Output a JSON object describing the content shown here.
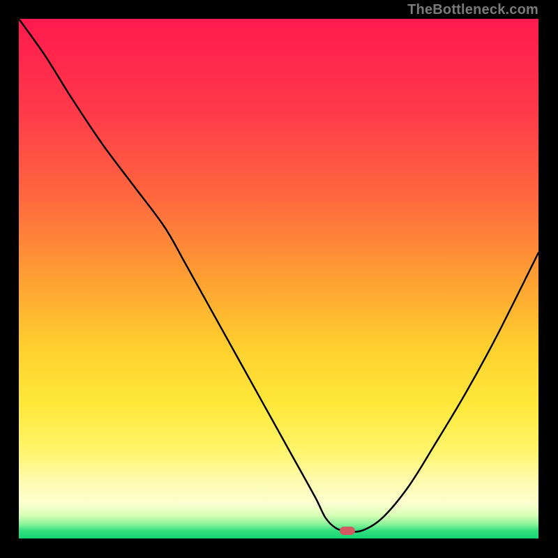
{
  "watermark": {
    "text": "TheBottleneck.com"
  },
  "marker": {
    "color": "#d45a62",
    "x_frac": 0.632,
    "y_frac": 0.985
  },
  "gradient_stops": [
    {
      "offset": 0.0,
      "color": "#ff1a4e"
    },
    {
      "offset": 0.18,
      "color": "#ff3a4a"
    },
    {
      "offset": 0.35,
      "color": "#ff6a3e"
    },
    {
      "offset": 0.5,
      "color": "#ffa033"
    },
    {
      "offset": 0.63,
      "color": "#ffcf2e"
    },
    {
      "offset": 0.74,
      "color": "#ffe83a"
    },
    {
      "offset": 0.83,
      "color": "#fff56a"
    },
    {
      "offset": 0.89,
      "color": "#fffbb0"
    },
    {
      "offset": 0.933,
      "color": "#fbffd0"
    },
    {
      "offset": 0.955,
      "color": "#d9ffb8"
    },
    {
      "offset": 0.972,
      "color": "#8ef59a"
    },
    {
      "offset": 0.985,
      "color": "#33e07f"
    },
    {
      "offset": 1.0,
      "color": "#14d673"
    }
  ],
  "chart_data": {
    "type": "line",
    "title": "",
    "xlabel": "",
    "ylabel": "",
    "xlim": [
      0,
      100
    ],
    "ylim": [
      0,
      100
    ],
    "series": [
      {
        "name": "bottleneck-curve",
        "x": [
          0,
          5,
          10,
          16,
          22,
          28,
          32,
          37,
          42,
          47,
          52,
          57,
          59,
          61,
          63,
          66,
          70,
          75,
          80,
          86,
          92,
          100
        ],
        "values": [
          100,
          93,
          85,
          76,
          68,
          60,
          53,
          44,
          35,
          26,
          17,
          8,
          4,
          2,
          1.5,
          1.5,
          4,
          10,
          18,
          28,
          39,
          55
        ]
      }
    ],
    "annotations": [
      {
        "type": "marker",
        "x": 63.2,
        "y": 1.5,
        "color": "#d45a62",
        "shape": "rounded-pill"
      }
    ],
    "background": "red-yellow-green vertical gradient",
    "grid": false,
    "legend": false
  }
}
